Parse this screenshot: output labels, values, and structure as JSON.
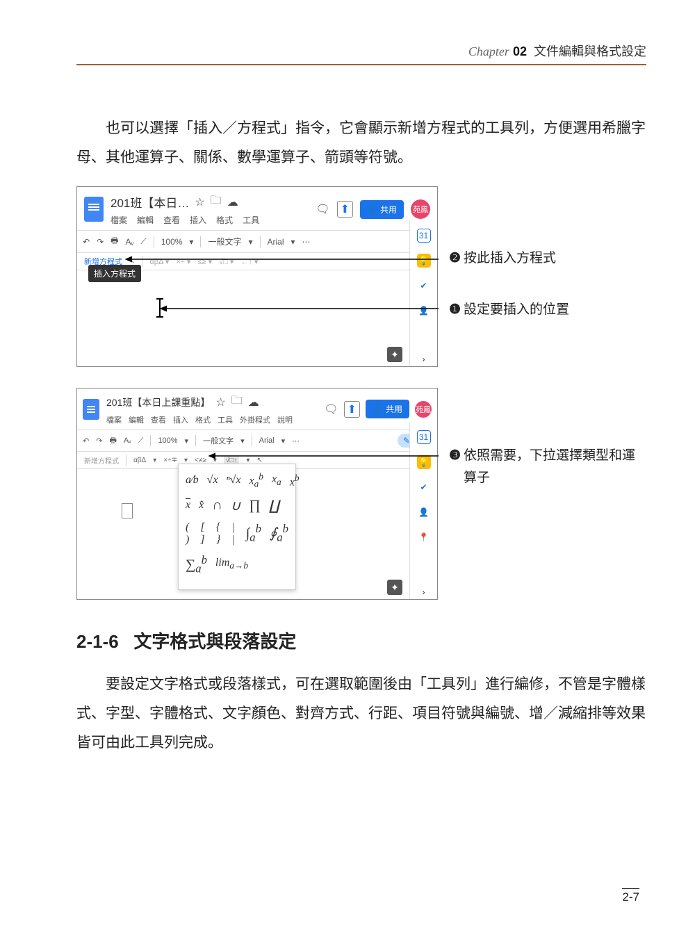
{
  "chapter": {
    "prefix": "Chapter",
    "num": "02",
    "title": "文件編輯與格式設定"
  },
  "para1": "也可以選擇「插入／方程式」指令，它會顯示新增方程式的工具列，方便選用希臘字母、其他運算子、關係、數學運算子、箭頭等符號。",
  "screenshot1": {
    "doc_title": "201班【本日…",
    "menus": [
      "檔案",
      "編輯",
      "查看",
      "插入",
      "格式",
      "工具"
    ],
    "toolbar": {
      "zoom": "100%",
      "style": "一般文字",
      "font": "Arial"
    },
    "equation_bar": {
      "new": "新增方程式"
    },
    "tooltip": "插入方程式",
    "share": "共用",
    "avatar": "苑鳳"
  },
  "callouts1": {
    "c2_num": "❷",
    "c2_text": "按此插入方程式",
    "c1_num": "❶",
    "c1_text": "設定要插入的位置"
  },
  "screenshot2": {
    "doc_title": "201班【本日上課重點】",
    "menus": [
      "檔案",
      "編輯",
      "查看",
      "插入",
      "格式",
      "工具",
      "外掛程式",
      "說明"
    ],
    "toolbar": {
      "zoom": "100%",
      "style": "一般文字",
      "font": "Arial"
    },
    "equation_bar": {
      "new": "新增方程式",
      "grp1": "αβΔ",
      "grp2": "×÷∓",
      "grp3": "<≠≥",
      "grp4": "√□↑"
    },
    "share": "共用",
    "avatar": "苑鳳"
  },
  "callouts2": {
    "c3_num": "❸",
    "c3_text": "依照需要，下拉選擇類型和運算子"
  },
  "heading": {
    "num": "2-1-6",
    "title": "文字格式與段落設定"
  },
  "para2": "要設定文字格式或段落樣式，可在選取範圍後由「工具列」進行編修，不管是字體樣式、字型、字體格式、文字顏色、對齊方式、行距、項目符號與編號、增／減縮排等效果皆可由此工具列完成。",
  "page_num": "2-7"
}
